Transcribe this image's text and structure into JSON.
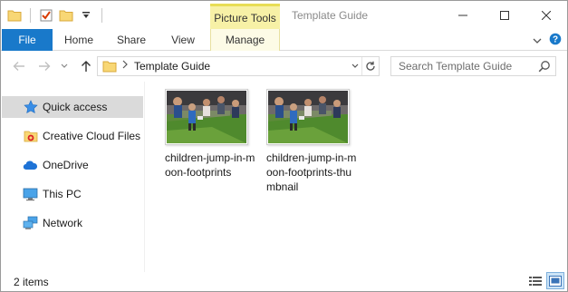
{
  "window": {
    "title": "Template Guide",
    "contextual_group": "Picture Tools"
  },
  "ribbon": {
    "tabs": [
      "File",
      "Home",
      "Share",
      "View",
      "Manage"
    ]
  },
  "address": {
    "path_segment": "Template Guide",
    "search_placeholder": "Search Template Guide"
  },
  "nav_pane": {
    "items": [
      {
        "label": "Quick access",
        "icon": "star-icon",
        "selected": true
      },
      {
        "label": "Creative Cloud Files",
        "icon": "creative-cloud-folder-icon",
        "selected": false
      },
      {
        "label": "OneDrive",
        "icon": "onedrive-cloud-icon",
        "selected": false
      },
      {
        "label": "This PC",
        "icon": "monitor-icon",
        "selected": false
      },
      {
        "label": "Network",
        "icon": "network-icon",
        "selected": false
      }
    ]
  },
  "files": [
    {
      "name": "children-jump-in-moon-footprints"
    },
    {
      "name": "children-jump-in-moon-footprints-thumbnail"
    }
  ],
  "status": {
    "item_count": "2 items"
  },
  "colors": {
    "file_tab": "#1979ca",
    "contextual_tab": "#f7f1a6",
    "selected_nav": "#dadada"
  }
}
